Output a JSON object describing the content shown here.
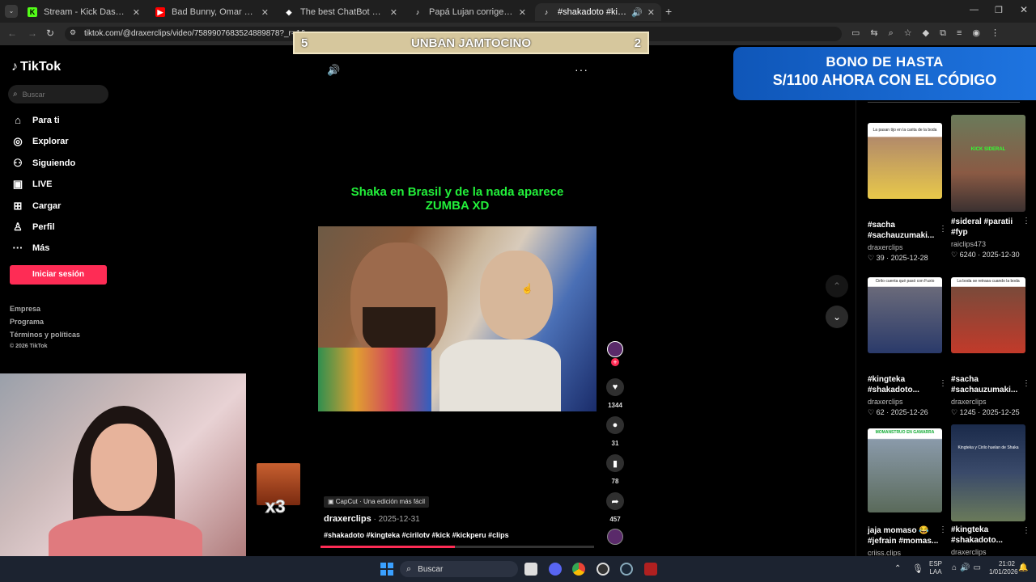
{
  "tabs": [
    {
      "title": "Stream - Kick Dashboard",
      "icon": "kick-icon",
      "color": "#53fc18"
    },
    {
      "title": "Bad Bunny, Omar Courtz, Dei V",
      "icon": "youtube-icon",
      "color": "#ff0000"
    },
    {
      "title": "The best ChatBot and Widgets",
      "icon": "streamelements-icon",
      "color": "#ffffff"
    },
    {
      "title": "Papá Lujan corrige a Jesús And",
      "icon": "tiktok-icon",
      "color": "#ffffff"
    },
    {
      "title": "#shakadoto #kingteka #ciril",
      "icon": "tiktok-icon",
      "color": "#ffffff"
    }
  ],
  "address": {
    "url": "tiktok.com/@draxerclips/video/7589907683524889878?_r=1&"
  },
  "overlay": {
    "unban_left": "5",
    "unban_text": "UNBAN JAMTOCINO",
    "unban_right": "2",
    "bono_line1": "BONO DE HASTA",
    "bono_line2": "S/1100 AHORA CON EL CÓDIGO"
  },
  "sidebar": {
    "logo": "TikTok",
    "search_placeholder": "Buscar",
    "items": [
      {
        "label": "Para ti",
        "icon": "home-icon"
      },
      {
        "label": "Explorar",
        "icon": "compass-icon"
      },
      {
        "label": "Siguiendo",
        "icon": "people-icon"
      },
      {
        "label": "LIVE",
        "icon": "live-icon"
      },
      {
        "label": "Cargar",
        "icon": "upload-icon"
      },
      {
        "label": "Perfil",
        "icon": "user-icon"
      },
      {
        "label": "Más",
        "icon": "more-icon"
      }
    ],
    "login": "Iniciar sesión",
    "footer": [
      "Empresa",
      "Programa",
      "Términos y políticas",
      "© 2026 TikTok"
    ]
  },
  "video": {
    "caption": "Shaka en Brasil y de la nada aparece ZUMBA XD",
    "capcut": "CapCut · Una edición más fácil",
    "author": "draxerclips",
    "date": "2025-12-31",
    "hashtags": "#shakadoto #kingteka #cirilotv #kick #kickperu #clips",
    "progress": 0.49
  },
  "actions": {
    "likes": "1344",
    "comments": "31",
    "saves": "78",
    "shares": "457"
  },
  "emote": {
    "label": "x3"
  },
  "grid": [
    {
      "title": "#sacha #sachauzumaki...",
      "author": "draxerclips",
      "likes": "39",
      "date": "2025-12-28",
      "thumb_text": "La pasan tijo en la carita de la boda",
      "color": "#b28a6a"
    },
    {
      "title": "#sideral #paratii #fyp",
      "author": "raiclips473",
      "likes": "6240",
      "date": "2025-12-30",
      "thumb_text": "KICK SIDERAL",
      "color": "#8a5a44"
    },
    {
      "title": "#kingteka #shakadoto...",
      "author": "draxerclips",
      "likes": "62",
      "date": "2025-12-26",
      "thumb_text": "Cirilo cuenta qué pasó con Fuxio",
      "color": "#6a6a7a"
    },
    {
      "title": "#sacha #sachauzumaki...",
      "author": "draxerclips",
      "likes": "1245",
      "date": "2025-12-25",
      "thumb_text": "La boda se retrasa cuando la boda",
      "color": "#7a4a3a"
    },
    {
      "title": "jaja momaso 😂 #jefrain #momas...",
      "author": "criiss.clips",
      "likes": "",
      "date": "",
      "thumb_text": "MOMANSTRUO EN GAMARRA",
      "color": "#6a7a8a"
    },
    {
      "title": "#kingteka #shakadoto...",
      "author": "draxerclips",
      "likes": "",
      "date": "",
      "thumb_text": "Kingteka y Cirilo huelan de Shaka",
      "color": "#3a4a6a"
    }
  ],
  "taskbar": {
    "search": "Buscar",
    "lang1": "ESP",
    "lang2": "LAA",
    "time": "21:02",
    "date": "1/01/2026"
  }
}
